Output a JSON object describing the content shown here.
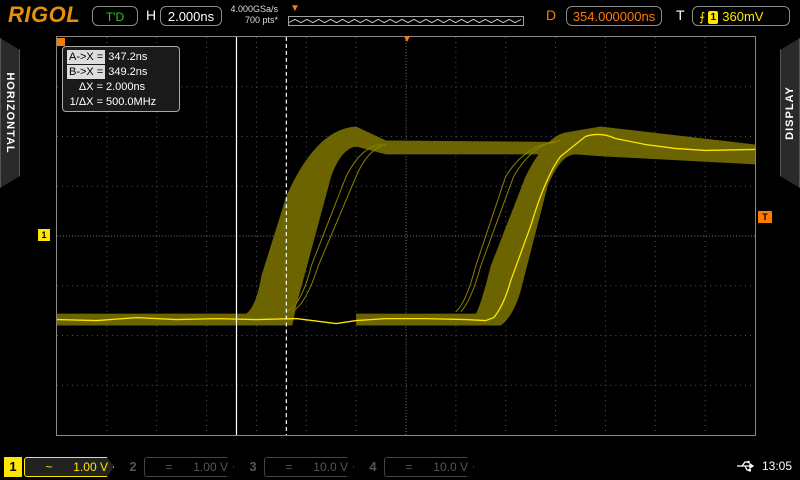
{
  "brand": {
    "logo": "RIGOL"
  },
  "status": {
    "mode": "T'D"
  },
  "horizontal": {
    "label": "H",
    "timebase": "2.000ns",
    "sample_rate": "4.000GSa/s",
    "mem_depth": "700 pts*"
  },
  "delay": {
    "label": "D",
    "value": "354.000000ns"
  },
  "trigger": {
    "label": "T",
    "edge_icon": "rising-edge",
    "source": "1",
    "level": "360mV"
  },
  "side_tabs": {
    "left": "HORIZONTAL",
    "right": "DISPLAY"
  },
  "markers": {
    "ch1": "1",
    "trigger": "T"
  },
  "cursors": {
    "a_label": "A->X =",
    "a_value": "347.2ns",
    "b_label": "B->X =",
    "b_value": "349.2ns",
    "delta_label": "ΔX =",
    "delta_value": "2.000ns",
    "inv_label": "1/ΔX =",
    "inv_value": "500.0MHz"
  },
  "channels": [
    {
      "num": "1",
      "coupling": "~",
      "scale": "1.00 V",
      "active": true
    },
    {
      "num": "2",
      "coupling": "=",
      "scale": "1.00 V",
      "active": false
    },
    {
      "num": "3",
      "coupling": "=",
      "scale": "10.0 V",
      "active": false
    },
    {
      "num": "4",
      "coupling": "=",
      "scale": "10.0 V",
      "active": false
    }
  ],
  "system": {
    "usb_icon": "usb-icon",
    "time": "13:05"
  },
  "colors": {
    "ch1": "#ffe600",
    "persistence": "#6b6400",
    "accent": "#ff7a00",
    "status_ok": "#2dc42d"
  }
}
